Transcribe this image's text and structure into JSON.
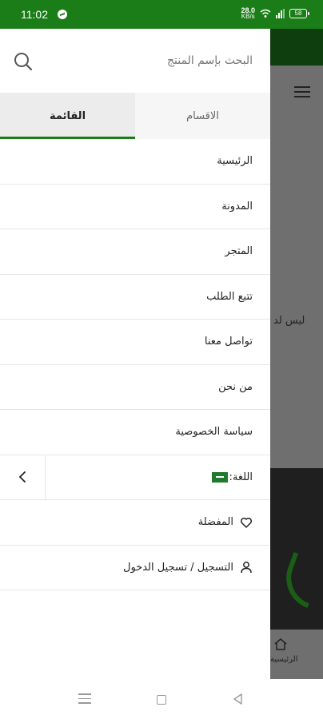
{
  "status_bar": {
    "time": "11:02",
    "net_speed_value": "28.0",
    "net_speed_unit": "KB/s",
    "battery": "58",
    "bg_color": "#1b7d17"
  },
  "background": {
    "partial_text": "ليس لد",
    "home_label": "الرئيسية"
  },
  "drawer": {
    "search": {
      "placeholder": "البحث بإسم المنتج"
    },
    "tabs": {
      "menu": "القائمة",
      "categories": "الاقسام",
      "active": "menu"
    },
    "items": [
      {
        "label": "الرئيسية"
      },
      {
        "label": "المدونة"
      },
      {
        "label": "المتجر"
      },
      {
        "label": "تتبع الطلب"
      },
      {
        "label": "تواصل معنا"
      },
      {
        "label": "من نحن"
      },
      {
        "label": "سياسة الخصوصية"
      }
    ],
    "language_label": "اللغة:",
    "favorites_label": "المفضلة",
    "login_label": "التسجيل / تسجيل الدخول",
    "accent_color": "#1b7d17"
  },
  "icons": {
    "search": "search-icon",
    "heart": "heart-icon",
    "user": "user-icon",
    "chevron": "chevron-left-icon",
    "flag": "saudi-flag-icon"
  }
}
